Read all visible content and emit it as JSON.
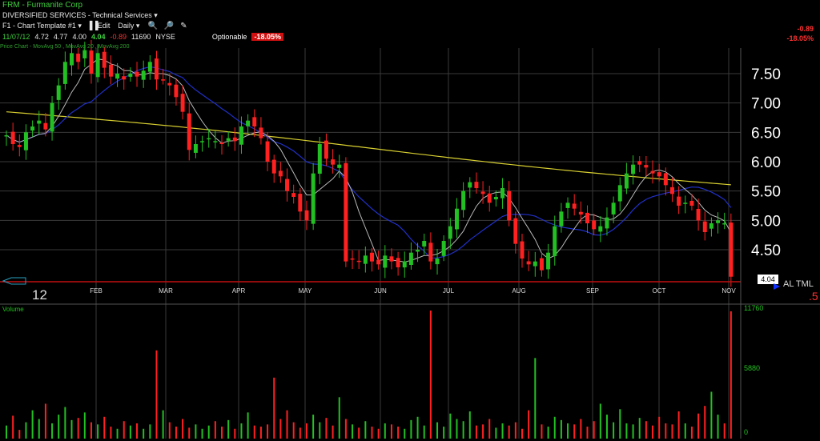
{
  "header": {
    "title": "FRM - Furmanite Corp",
    "sector": "DIVERSIFIED SERVICES - Technical Services ▾",
    "toolbar": {
      "template": "F1 - Chart Template #1 ▾",
      "edit": "Edit",
      "period": "Daily ▾",
      "zoom_in_icon": "zoom-in-icon",
      "zoom_out_icon": "zoom-out-icon",
      "draw_icon": "pencil-icon"
    },
    "quote": {
      "date": "11/07/12",
      "open": "4.72",
      "high": "4.77",
      "low": "4.00",
      "close": "4.04",
      "change": "-0.89",
      "volume": "11690",
      "exchange": "NYSE",
      "optionable": "Optionable",
      "pct_change": "-18.05%"
    },
    "studies": "Price Chart - MovAvg 50 , MovAvg 20 , MovAvg 200",
    "right_change": "-0.89",
    "right_pct": "-18.05%"
  },
  "colors": {
    "up": "#22c022",
    "down": "#ff2020",
    "ma20": "#b8b8b8",
    "ma50": "#2030c8",
    "ma200": "#d8d030",
    "grid": "#3a3a3a",
    "axis_text": "#ffffff",
    "volume_text": "#22c022"
  },
  "price_axis": {
    "ticks": [
      "7.50",
      "7.00",
      "6.50",
      "6.00",
      "5.50",
      "5.00",
      "4.50"
    ],
    "last_price_box": "4.04",
    "overlay_text": "AL TML",
    "overlay_small": ".5"
  },
  "volume_axis": {
    "label": "Volume",
    "ticks": [
      "11760",
      "5880",
      "0"
    ]
  },
  "months": [
    "12",
    "FEB",
    "MAR",
    "APR",
    "MAY",
    "JUN",
    "JUL",
    "AUG",
    "SEP",
    "OCT",
    "NOV"
  ],
  "chart_data": {
    "type": "candlestick",
    "symbol": "FRM",
    "ylim": [
      4.04,
      7.9
    ],
    "volume_ylim": [
      0,
      11760
    ],
    "months": [
      "12",
      "FEB",
      "MAR",
      "APR",
      "MAY",
      "JUN",
      "JUL",
      "AUG",
      "SEP",
      "OCT",
      "NOV"
    ],
    "close_series": [
      6.45,
      6.3,
      6.25,
      6.5,
      6.6,
      6.7,
      6.55,
      7.0,
      7.3,
      7.7,
      7.85,
      7.7,
      7.9,
      7.5,
      7.85,
      7.6,
      7.45,
      7.5,
      7.4,
      7.5,
      7.45,
      7.55,
      7.7,
      7.4,
      7.4,
      7.3,
      7.1,
      6.85,
      6.2,
      6.3,
      6.35,
      6.4,
      6.35,
      6.3,
      6.4,
      6.35,
      6.6,
      6.7,
      6.6,
      6.4,
      6.0,
      5.8,
      5.75,
      5.5,
      5.4,
      5.15,
      5.0,
      5.8,
      6.3,
      6.05,
      5.95,
      5.95,
      4.3,
      4.35,
      4.3,
      4.4,
      4.3,
      4.25,
      4.4,
      4.3,
      4.2,
      4.3,
      4.45,
      4.5,
      4.65,
      4.3,
      4.35,
      4.65,
      4.9,
      5.2,
      5.5,
      5.65,
      5.55,
      5.45,
      5.3,
      5.4,
      5.55,
      5.0,
      4.6,
      4.35,
      4.25,
      4.3,
      4.15,
      4.45,
      4.9,
      5.15,
      5.3,
      5.2,
      5.1,
      4.95,
      4.85,
      4.9,
      5.05,
      5.3,
      5.6,
      5.8,
      5.95,
      5.95,
      5.9,
      5.8,
      5.75,
      5.6,
      5.45,
      5.25,
      5.3,
      5.25,
      5.0,
      4.8,
      4.95,
      5.0,
      4.95,
      4.04
    ],
    "volume_series": [
      1200,
      2100,
      800,
      1500,
      2600,
      1800,
      3200,
      1400,
      2200,
      2900,
      1700,
      1900,
      2400,
      1500,
      1300,
      2000,
      1100,
      900,
      1600,
      1200,
      1400,
      900,
      1300,
      8100,
      2600,
      1500,
      1100,
      1800,
      1000,
      1300,
      900,
      1200,
      1600,
      1100,
      1700,
      900,
      1400,
      2400,
      1200,
      1100,
      1300,
      5600,
      1800,
      2600,
      1500,
      1000,
      1400,
      2200,
      1500,
      1900,
      1200,
      3800,
      1800,
      1300,
      1000,
      1600,
      1100,
      900,
      1400,
      1300,
      1100,
      900,
      1700,
      2000,
      1200,
      11760,
      1500,
      1100,
      2300,
      1800,
      1600,
      2500,
      1200,
      1300,
      1800,
      1000,
      1400,
      1200,
      1500,
      900,
      2600,
      7400,
      1300,
      1100,
      2000,
      1700,
      1400,
      1300,
      1800,
      1100,
      1600,
      3200,
      2200,
      1500,
      2700,
      1400,
      1300,
      1900,
      1600,
      1200,
      2000,
      1400,
      1300,
      2500,
      1400,
      1100,
      2300,
      3000,
      4300,
      2200,
      1400,
      11690
    ]
  }
}
